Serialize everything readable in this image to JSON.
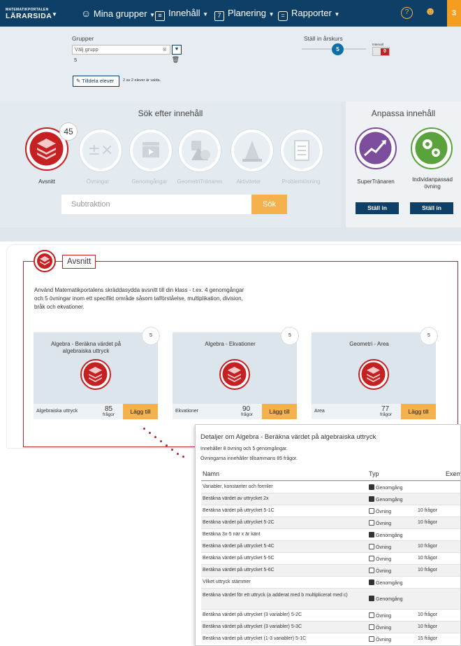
{
  "topbar": {
    "logo_small": "MATEMATIKPORTALEN",
    "logo_big": "LÄRARSIDA",
    "nav": [
      "Mina grupper",
      "Innehåll",
      "Planering",
      "Rapporter"
    ],
    "notif_count": "3"
  },
  "settings": {
    "groups_label": "Grupper",
    "group_placeholder": "Välj grupp",
    "group_value": "5",
    "assign_label": "Tilldela elever",
    "selected_text": "2 av 2 elever är valda.",
    "grade_label": "Ställ in årskurs",
    "grade_value": "5",
    "toggle_small": "Intervall",
    "toggle_value": "0"
  },
  "search": {
    "title": "Sök efter innehåll",
    "badge": "45",
    "categories": [
      "Avsnitt",
      "Övningar",
      "Genomgångar",
      "GeometriTränaren",
      "Aktiviteter",
      "Problemlösning"
    ],
    "input_value": "Subtraktion",
    "button": "Sök"
  },
  "custom": {
    "title": "Anpassa innehåll",
    "items": [
      "SuperTränaren",
      "Individanpassad övning"
    ],
    "button": "Ställ in"
  },
  "avsnitt": {
    "title": "Avsnitt",
    "description": "Använd Matematikportalens skräddasydda avsnitt till din klass - t.ex. 4 genomgångar och 5 övningar inom ett specifikt område såsom talförståelse, multiplikation, division, bråk och ekvationer.",
    "cards": [
      {
        "title": "Algebra - Beräkna värdet på algebraiska uttryck",
        "badge": "5",
        "tag": "Algebraiska uttryck",
        "count": "85",
        "unit": "frågor",
        "button": "Lägg till"
      },
      {
        "title": "Algebra - Ekvationer",
        "badge": "5",
        "tag": "Ekvationer",
        "count": "90",
        "unit": "frågor",
        "button": "Lägg till"
      },
      {
        "title": "Geometri - Area",
        "badge": "5",
        "tag": "Area",
        "count": "77",
        "unit": "frågor",
        "button": "Lägg till"
      }
    ]
  },
  "details": {
    "title": "Detaljer om Algebra - Beräkna värdet på algebraiska uttryck",
    "line1": "Innehåller 8 övning och 5 genomgångar.",
    "line2": "Övningarna innehåller tillsammans 85 frågor.",
    "headers": [
      "Namn",
      "Typ",
      "Exem"
    ],
    "rows": [
      {
        "name": "Variabler, konstanter och formler",
        "type": "Genomgång",
        "q": ""
      },
      {
        "name": "Beräkna värdet av uttrycket 2x",
        "type": "Genomgång",
        "q": ""
      },
      {
        "name": "Beräkna värdet på uttrycket 5-1C",
        "type": "Övning",
        "q": "10 frågor"
      },
      {
        "name": "Beräkna värdet på uttrycket 5-2C",
        "type": "Övning",
        "q": "10 frågor"
      },
      {
        "name": "Beräkna 3x-5 när x är känt",
        "type": "Genomgång",
        "q": ""
      },
      {
        "name": "Beräkna värdet på uttrycket 5-4C",
        "type": "Övning",
        "q": "10 frågor"
      },
      {
        "name": "Beräkna värdet på uttrycket 5-5C",
        "type": "Övning",
        "q": "10 frågor"
      },
      {
        "name": "Beräkna värdet på uttrycket 5-6C",
        "type": "Övning",
        "q": "10 frågor"
      },
      {
        "name": "Vilket uttryck stämmer",
        "type": "Genomgång",
        "q": ""
      },
      {
        "name": "Beräkna värdet för ett uttryck (a adderat med b multiplicerat med c)",
        "type": "Genomgång",
        "q": ""
      },
      {
        "name": "Beräkna värdet på uttrycket (3 variabler) 5-2C",
        "type": "Övning",
        "q": "10 frågor"
      },
      {
        "name": "Beräkna värdet på uttrycket (3 variabler) 5-3C",
        "type": "Övning",
        "q": "10 frågor"
      },
      {
        "name": "Beräkna värdet på uttrycket (1-3 variabler) 5-1C",
        "type": "Övning",
        "q": "15 frågor"
      }
    ]
  },
  "colors": {
    "brand": "#0e3f66",
    "accent": "#f5b14c",
    "red": "#c52022"
  }
}
